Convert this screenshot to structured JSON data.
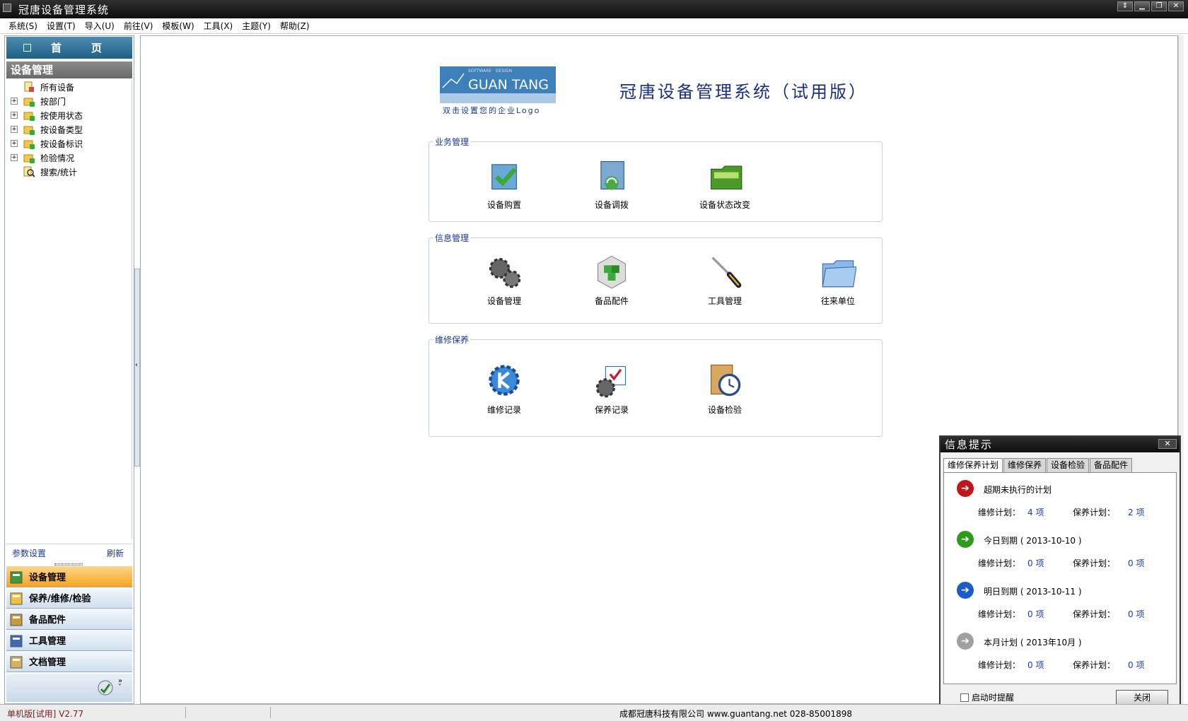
{
  "window": {
    "title": "冠唐设备管理系统"
  },
  "menu": [
    "系统(S)",
    "设置(T)",
    "导入(U)",
    "前往(V)",
    "模板(W)",
    "工具(X)",
    "主题(Y)",
    "帮助(Z)"
  ],
  "menu_keys": [
    "S",
    "T",
    "U",
    "V",
    "W",
    "X",
    "Y",
    "Z"
  ],
  "menu_names": [
    "系统",
    "设置",
    "导入",
    "前往",
    "模板",
    "工具",
    "主题",
    "帮助"
  ],
  "sidebar": {
    "home": {
      "char1": "首",
      "char2": "页"
    },
    "section": "设备管理",
    "tree": [
      "所有设备",
      "按部门",
      "按使用状态",
      "按设备类型",
      "按设备标识",
      "检验情况",
      "搜索/统计"
    ],
    "param_settings": "参数设置",
    "refresh": "刷新",
    "nav": [
      "设备管理",
      "保养/维修/检验",
      "备品配件",
      "工具管理",
      "文档管理"
    ]
  },
  "main": {
    "logo": {
      "brand": "GUAN TANG",
      "tagline": "SOFTWARE · DESIGN",
      "hint": "双击设置您的企业Logo"
    },
    "app_title": "冠唐设备管理系统（试用版）",
    "groups": [
      {
        "label": "业务管理",
        "items": [
          "设备购置",
          "设备调拨",
          "设备状态改变"
        ]
      },
      {
        "label": "信息管理",
        "items": [
          "设备管理",
          "备品配件",
          "工具管理",
          "往来单位"
        ]
      },
      {
        "label": "维修保养",
        "items": [
          "维修记录",
          "保养记录",
          "设备检验"
        ]
      }
    ]
  },
  "popup": {
    "title": "信息提示",
    "close_x": "✕",
    "tabs": [
      "维修保养计划",
      "维修保养",
      "设备检验",
      "备品配件"
    ],
    "rows": [
      {
        "title": "超期未执行的计划",
        "repair_label": "维修计划：",
        "repair": "4 项",
        "maint_label": "保养计划：",
        "maint": "2 项",
        "color": "#c0161a"
      },
      {
        "title": "今日到期 ( 2013-10-10 )",
        "repair_label": "维修计划：",
        "repair": "0 项",
        "maint_label": "保养计划：",
        "maint": "0 项",
        "color": "#2e9a1e"
      },
      {
        "title": "明日到期 ( 2013-10-11 )",
        "repair_label": "维修计划：",
        "repair": "0 项",
        "maint_label": "保养计划：",
        "maint": "0 项",
        "color": "#1a5cc8"
      },
      {
        "title": "本月计划 ( 2013年10月 )",
        "repair_label": "维修计划：",
        "repair": "0 项",
        "maint_label": "保养计划：",
        "maint": "0 项",
        "color": "#a0a0a0"
      }
    ],
    "startup_label": "启动时提醒",
    "close_button": "关闭"
  },
  "status": {
    "edition": "单机版[试用]  V2.77",
    "company": "成都冠唐科技有限公司  www.guantang.net  028-85001898"
  }
}
